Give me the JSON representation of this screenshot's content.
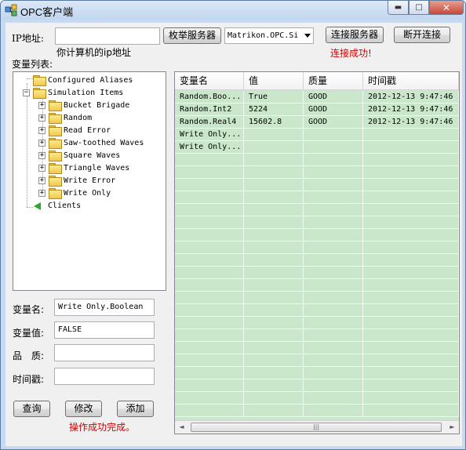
{
  "window": {
    "title": "OPC客户端",
    "caption_min": "▬",
    "caption_max": "□",
    "caption_close": "✕"
  },
  "connection": {
    "ip_label": "IP地址:",
    "ip_value": "",
    "ip_hint": "你计算机的ip地址",
    "enum_button": "枚举服务器",
    "server_selected": "Matrikon.OPC.Si",
    "connect_button": "连接服务器",
    "disconnect_button": "断开连接",
    "status": "连接成功!"
  },
  "tree": {
    "label": "变量列表:",
    "nodes": [
      {
        "label": "Configured Aliases",
        "icon": "folder-icon",
        "expander": ""
      },
      {
        "label": "Simulation Items",
        "icon": "folder-icon",
        "expander": "−"
      },
      {
        "label": "Bucket Brigade",
        "icon": "folder-icon",
        "expander": "+"
      },
      {
        "label": "Random",
        "icon": "folder-icon",
        "expander": "+"
      },
      {
        "label": "Read Error",
        "icon": "folder-icon",
        "expander": "+"
      },
      {
        "label": "Saw-toothed Waves",
        "icon": "folder-icon",
        "expander": "+"
      },
      {
        "label": "Square Waves",
        "icon": "folder-icon",
        "expander": "+"
      },
      {
        "label": "Triangle Waves",
        "icon": "folder-icon",
        "expander": "+"
      },
      {
        "label": "Write Error",
        "icon": "folder-icon",
        "expander": "+"
      },
      {
        "label": "Write Only",
        "icon": "folder-icon",
        "expander": "+"
      },
      {
        "label": "Clients",
        "icon": "clients-icon",
        "expander": ""
      }
    ]
  },
  "form": {
    "name_label": "变量名:",
    "name_value": "Write Only.Boolean",
    "value_label": "变量值:",
    "value_value": "FALSE",
    "quality_label": "品　质:",
    "quality_value": "",
    "timestamp_label": "时间戳:",
    "timestamp_value": "",
    "query_button": "查询",
    "modify_button": "修改",
    "add_button": "添加",
    "result": "操作成功完成。"
  },
  "grid": {
    "columns": [
      "变量名",
      "值",
      "质量",
      "时间戳"
    ],
    "rows": [
      [
        "Random.Boo...",
        "True",
        "GOOD",
        "2012-12-13 9:47:46"
      ],
      [
        "Random.Int2",
        "5224",
        "GOOD",
        "2012-12-13 9:47:46"
      ],
      [
        "Random.Real4",
        "15602.8",
        "GOOD",
        "2012-12-13 9:47:46"
      ],
      [
        "Write Only...",
        "",
        "",
        ""
      ],
      [
        "Write Only...",
        "",
        "",
        ""
      ]
    ],
    "scroll_left": "◄",
    "scroll_right": "►",
    "scroll_thumb": "|||"
  }
}
